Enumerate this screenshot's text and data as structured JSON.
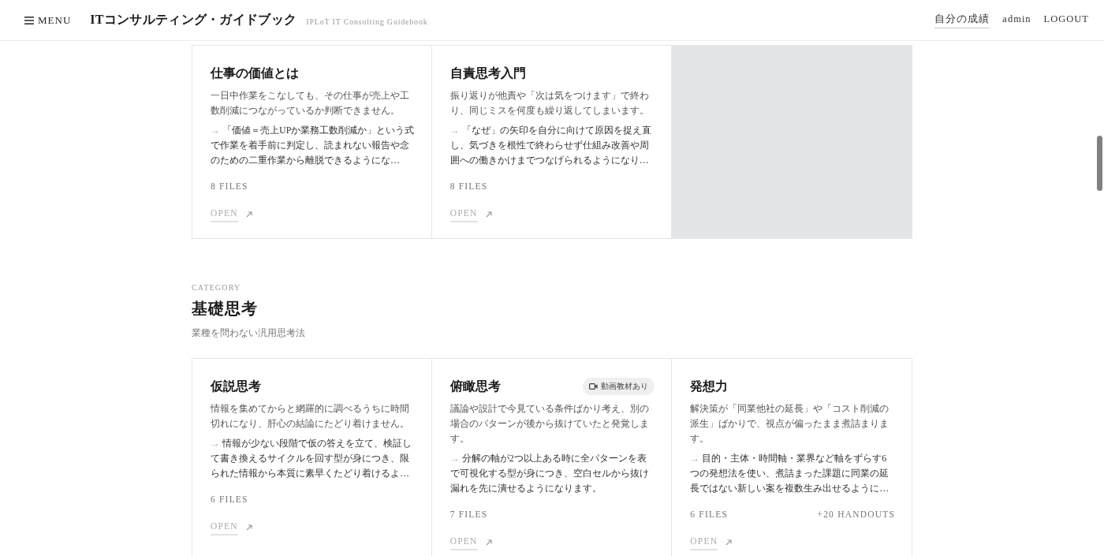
{
  "header": {
    "menu_label": "MENU",
    "title": "ITコンサルティング・ガイドブック",
    "subtitle": "IPLoT IT Consulting Guidebook",
    "nav": [
      {
        "label": "自分の成績",
        "selected": true
      },
      {
        "label": "admin",
        "selected": false
      },
      {
        "label": "LOGOUT",
        "selected": false
      }
    ]
  },
  "sections": [
    {
      "cards": [
        {
          "kind": "course",
          "title": "仕事の価値とは",
          "problem": "一日中作業をこなしても、その仕事が売上や工数削減につながっているか判断できません。",
          "marker": "→",
          "outcome": "「価値＝売上UPか業務工数削減か」という式で作業を着手前に判定し、読まれない報告や念のための二重作業から離脱できるようにな…",
          "files": "8 FILES",
          "open": "OPEN"
        },
        {
          "kind": "course",
          "title": "自責思考入門",
          "problem": "振り返りが他責や「次は気をつけます」で終わり、同じミスを何度も繰り返してしまいます。",
          "marker": "→",
          "outcome": "「なぜ」の矢印を自分に向けて原因を捉え直し、気づきを根性で終わらせず仕組み改善や周囲への働きかけまでつなげられるようになり…",
          "files": "8 FILES",
          "open": "OPEN"
        },
        {
          "kind": "empty"
        }
      ]
    },
    {
      "eyebrow": "CATEGORY",
      "title": "基礎思考",
      "subtitle": "業種を問わない汎用思考法",
      "cards": [
        {
          "kind": "course",
          "title": "仮説思考",
          "problem": "情報を集めてからと網羅的に調べるうちに時間切れになり、肝心の結論にたどり着けません。",
          "marker": "→",
          "outcome": "情報が少ない段階で仮の答えを立て、検証して書き換えるサイクルを回す型が身につき、限られた情報から本質に素早くたどり着けるよ…",
          "files": "6 FILES",
          "open": "OPEN"
        },
        {
          "kind": "course",
          "title": "俯瞰思考",
          "badge": "動画教材あり",
          "problem": "議論や設計で今見ている条件ばかり考え、別の場合のパターンが後から抜けていたと発覚します。",
          "marker": "→",
          "outcome": "分解の軸が2つ以上ある時に全パターンを表で可視化する型が身につき、空白セルから抜け漏れを先に潰せるようになります。",
          "files": "7 FILES",
          "open": "OPEN"
        },
        {
          "kind": "course",
          "title": "発想力",
          "problem": "解決策が「同業他社の延長」や「コスト削減の派生」ばかりで、視点が偏ったまま煮詰まります。",
          "marker": "→",
          "outcome": "目的・主体・時間軸・業界など軸をずらす6つの発想法を使い、煮詰まった課題に同業の延長ではない新しい案を複数生み出せるように…",
          "files": "6 FILES",
          "handouts": "+20 HANDOUTS",
          "open": "OPEN"
        }
      ]
    }
  ]
}
